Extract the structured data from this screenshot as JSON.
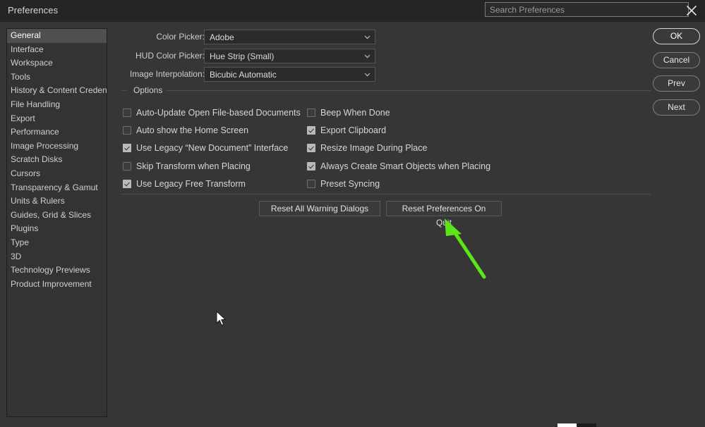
{
  "window": {
    "title": "Preferences",
    "close_icon": "close-icon"
  },
  "search": {
    "placeholder": "Search Preferences",
    "value": ""
  },
  "sidebar": {
    "selected": "General",
    "items": [
      {
        "label": "General"
      },
      {
        "label": "Interface"
      },
      {
        "label": "Workspace"
      },
      {
        "label": "Tools"
      },
      {
        "label": "History & Content Credentials"
      },
      {
        "label": "File Handling"
      },
      {
        "label": "Export"
      },
      {
        "label": "Performance"
      },
      {
        "label": "Image Processing"
      },
      {
        "label": "Scratch Disks"
      },
      {
        "label": "Cursors"
      },
      {
        "label": "Transparency & Gamut"
      },
      {
        "label": "Units & Rulers"
      },
      {
        "label": "Guides, Grid & Slices"
      },
      {
        "label": "Plugins"
      },
      {
        "label": "Type"
      },
      {
        "label": "3D"
      },
      {
        "label": "Technology Previews"
      },
      {
        "label": "Product Improvement"
      }
    ]
  },
  "fields": [
    {
      "label": "Color Picker:",
      "value": "Adobe"
    },
    {
      "label": "HUD Color Picker:",
      "value": "Hue Strip (Small)"
    },
    {
      "label": "Image Interpolation:",
      "value": "Bicubic Automatic"
    }
  ],
  "options_group": {
    "title": "Options",
    "left_column": [
      {
        "label": "Auto-Update Open File-based Documents",
        "checked": false
      },
      {
        "label": "Auto show the Home Screen",
        "checked": false
      },
      {
        "label": "Use Legacy “New Document” Interface",
        "checked": true
      },
      {
        "label": "Skip Transform when Placing",
        "checked": false
      },
      {
        "label": "Use Legacy Free Transform",
        "checked": true
      }
    ],
    "right_column": [
      {
        "label": "Beep When Done",
        "checked": false
      },
      {
        "label": "Export Clipboard",
        "checked": true
      },
      {
        "label": "Resize Image During Place",
        "checked": true
      },
      {
        "label": "Always Create Smart Objects when Placing",
        "checked": true
      },
      {
        "label": "Preset Syncing",
        "checked": false
      }
    ]
  },
  "reset_buttons": [
    {
      "label": "Reset All Warning Dialogs"
    },
    {
      "label": "Reset Preferences On Quit"
    }
  ],
  "action_buttons": [
    {
      "label": "OK",
      "primary": true
    },
    {
      "label": "Cancel",
      "primary": false
    },
    {
      "label": "Prev",
      "primary": false
    },
    {
      "label": "Next",
      "primary": false
    }
  ],
  "annotation": {
    "arrow_color": "#5ce619",
    "points_to": "Reset Preferences On Quit"
  },
  "colors": {
    "titlebar_bg": "#252525",
    "body_bg": "#363636",
    "panel_bg": "#333333",
    "selection_bg": "#4f4f4f",
    "text": "#d4d4d4"
  }
}
